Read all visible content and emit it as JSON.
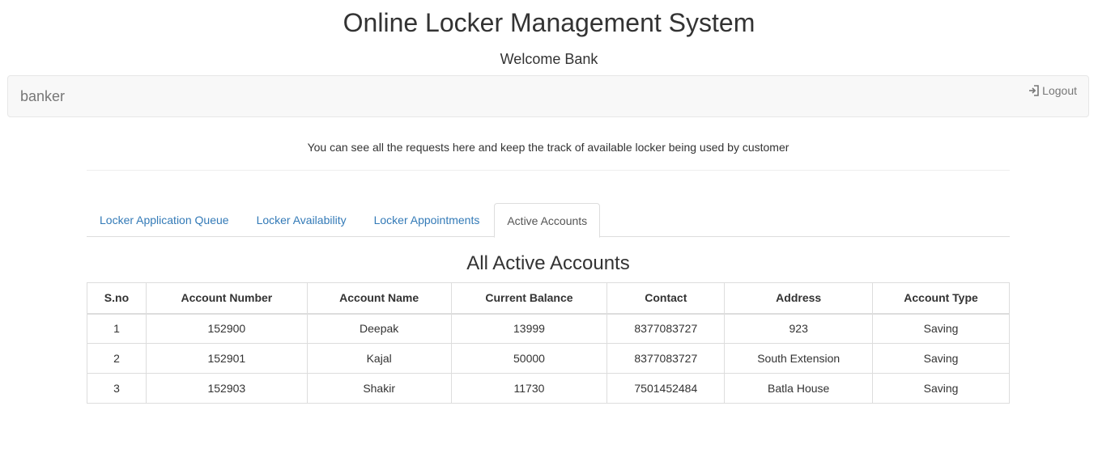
{
  "header": {
    "title": "Online Locker Management System",
    "welcome": "Welcome Bank"
  },
  "navbar": {
    "brand": "banker",
    "logout_label": "Logout",
    "logout_icon": "log-in-icon"
  },
  "intro_text": "You can see all the requests here and keep the track of available locker being used by customer",
  "tabs": [
    {
      "label": "Locker Application Queue",
      "active": false
    },
    {
      "label": "Locker Availability",
      "active": false
    },
    {
      "label": "Locker Appointments",
      "active": false
    },
    {
      "label": "Active Accounts",
      "active": true
    }
  ],
  "accounts_table": {
    "title": "All Active Accounts",
    "columns": [
      "S.no",
      "Account Number",
      "Account Name",
      "Current Balance",
      "Contact",
      "Address",
      "Account Type"
    ],
    "rows": [
      [
        "1",
        "152900",
        "Deepak",
        "13999",
        "8377083727",
        "923",
        "Saving"
      ],
      [
        "2",
        "152901",
        "Kajal",
        "50000",
        "8377083727",
        "South Extension",
        "Saving"
      ],
      [
        "3",
        "152903",
        "Shakir",
        "11730",
        "7501452484",
        "Batla House",
        "Saving"
      ]
    ]
  },
  "colors": {
    "link": "#337ab7",
    "navbar_bg": "#f8f8f8",
    "border": "#dddddd"
  }
}
